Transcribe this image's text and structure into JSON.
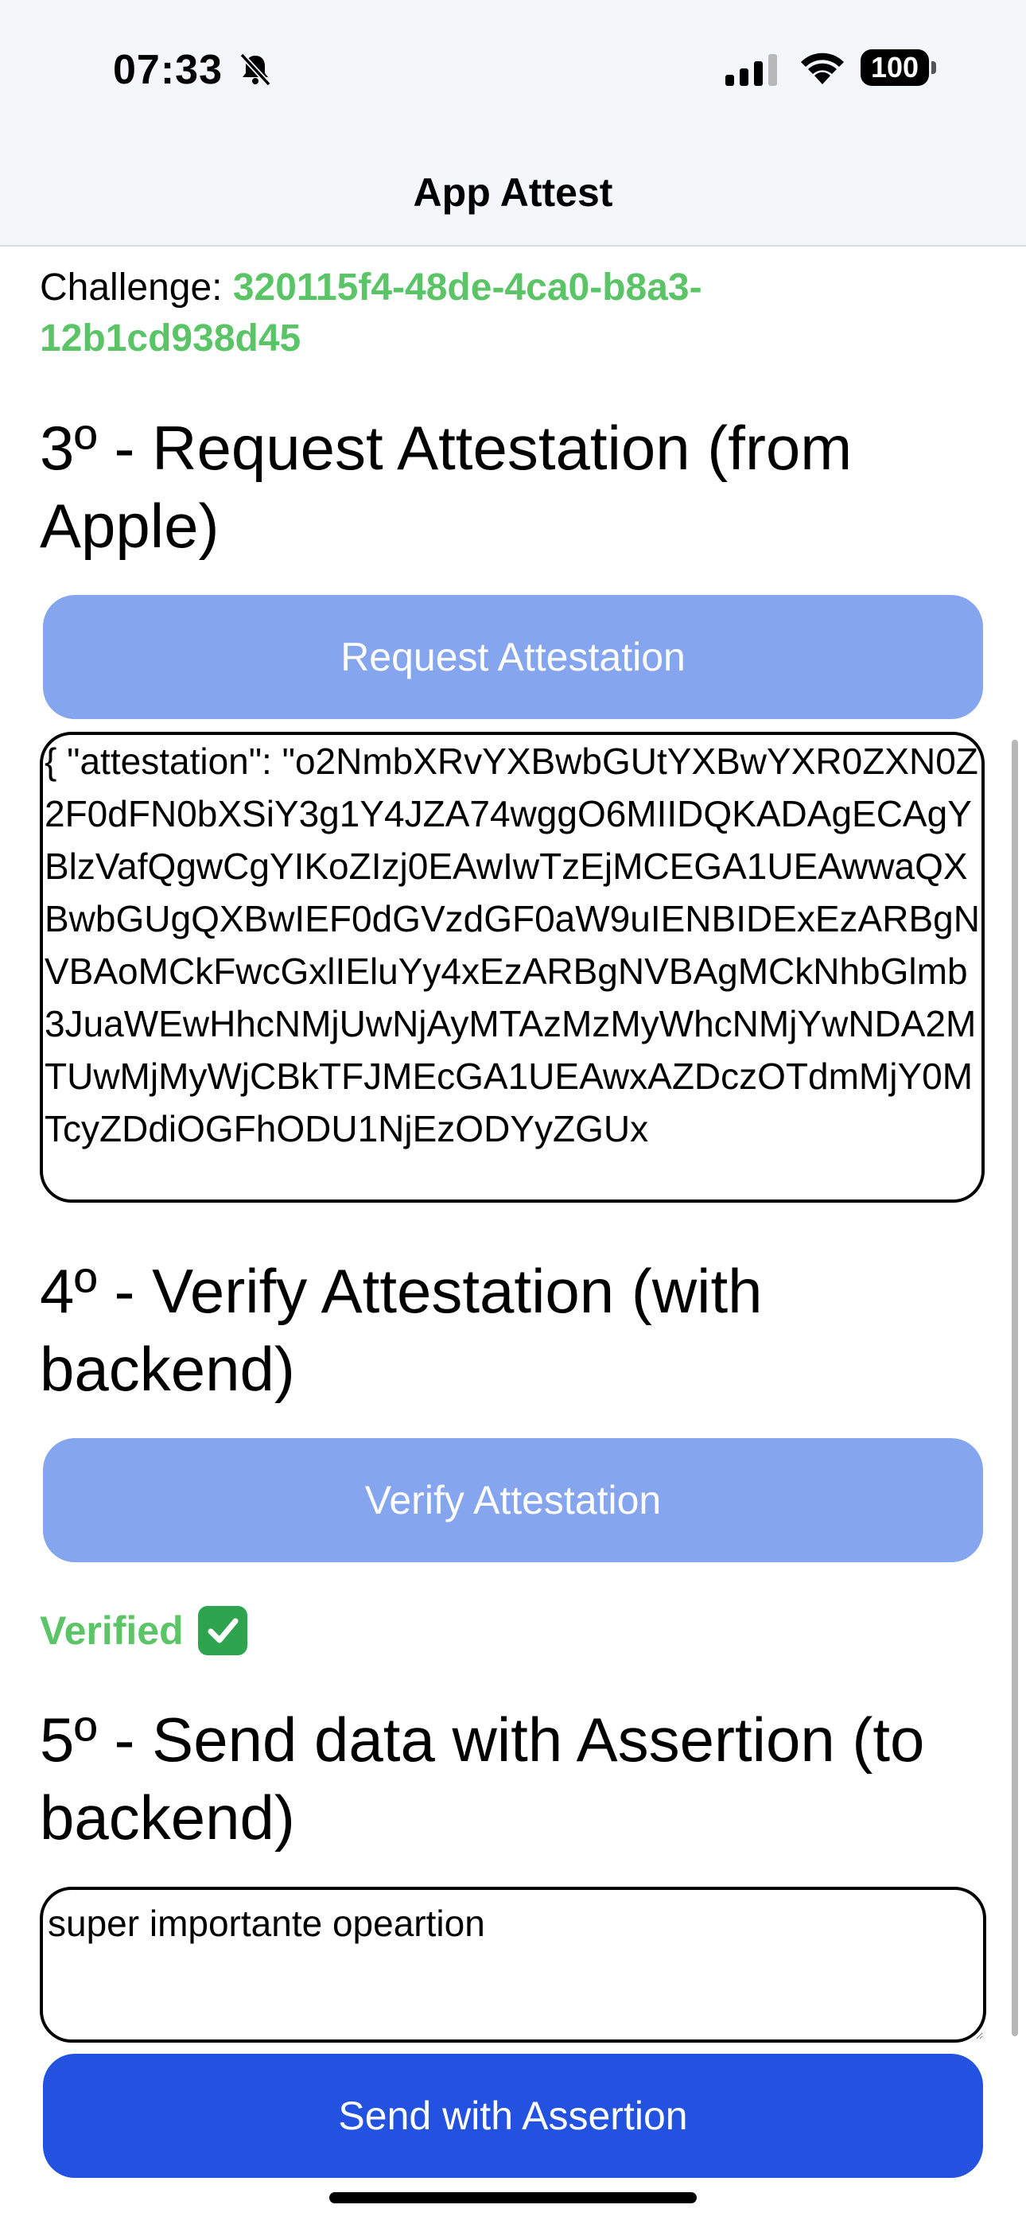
{
  "status_bar": {
    "time": "07:33",
    "battery": "100",
    "icons": [
      "bell-slash-icon",
      "cellular-signal-icon",
      "wifi-icon",
      "battery-icon"
    ]
  },
  "nav": {
    "title": "App Attest"
  },
  "challenge": {
    "label": "Challenge: ",
    "value": "320115f4-48de-4ca0-b8a3-12b1cd938d45"
  },
  "step3": {
    "heading": "3º - Request Attestation (from Apple)",
    "button_label": "Request Attestation",
    "result_text": "{ \"attestation\": \"o2NmbXRvYXBwbGUtYXBwYXR0ZXN0Z2F0dFN0bXSiY3g1Y4JZA74wggO6MIIDQKADAgECAgYBlzVafQgwCgYIKoZIzj0EAwIwTzEjMCEGA1UEAwwaQXBwbGUgQXBwIEF0dGVzdGF0aW9uIENBIDExEzARBgNVBAoMCkFwcGxlIEluYy4xEzARBgNVBAgMCkNhbGlmb3JuaWEwHhcNMjUwNjAyMTAzMzMyWhcNMjYwNDA2MTUwMjMyWjCBkTFJMEcGA1UEAwxAZDczOTdmMjY0MTcyZDdiOGFhODU1NjEzODYyZGUx"
  },
  "step4": {
    "heading": "4º - Verify Attestation (with backend)",
    "button_label": "Verify Attestation",
    "status": "Verified"
  },
  "step5": {
    "heading": "5º - Send data with Assertion (to backend)",
    "input_value": "super importante opeartion",
    "button_label": "Send with Assertion"
  },
  "colors": {
    "accent_green": "#5ac466",
    "button_light": "#85a5ef",
    "button_strong": "#2352e0"
  }
}
